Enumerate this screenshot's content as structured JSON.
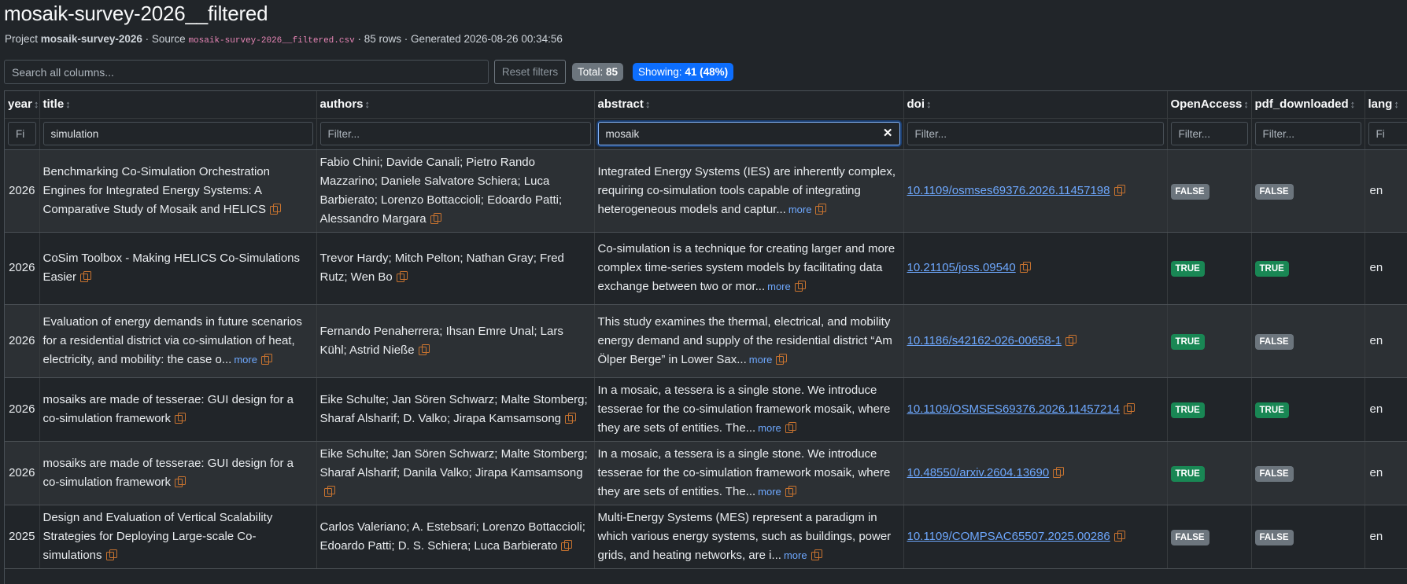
{
  "header": {
    "title": "mosaik-survey-2026__filtered",
    "project_prefix": "Project",
    "project_name": "mosaik-survey-2026",
    "source_prefix": "· Source",
    "source_file": "mosaik-survey-2026__filtered.csv",
    "rows_text": "· 85 rows · Generated 2026-08-26 00:34:56"
  },
  "toolbar": {
    "search_placeholder": "Search all columns...",
    "reset_label": "Reset filters",
    "total_label": "Total:",
    "total_value": "85",
    "showing_label": "Showing:",
    "showing_value": "41 (48%)"
  },
  "columns": [
    {
      "label": "year",
      "filter_value": "",
      "filter_placeholder": "Fi"
    },
    {
      "label": "title",
      "filter_value": "simulation",
      "filter_placeholder": "Filter..."
    },
    {
      "label": "authors",
      "filter_value": "",
      "filter_placeholder": "Filter..."
    },
    {
      "label": "abstract",
      "filter_value": "mosaik",
      "filter_placeholder": "Filter..."
    },
    {
      "label": "doi",
      "filter_value": "",
      "filter_placeholder": "Filter..."
    },
    {
      "label": "OpenAccess",
      "filter_value": "",
      "filter_placeholder": "Filter..."
    },
    {
      "label": "pdf_downloaded",
      "filter_value": "",
      "filter_placeholder": "Filter..."
    },
    {
      "label": "lang",
      "filter_value": "",
      "filter_placeholder": "Fi"
    }
  ],
  "sort_icon": "↕",
  "clear_icon": "✕",
  "more_label": "more",
  "colors": {
    "bg": "#212529",
    "accent": "#0d6efd",
    "link": "#6ea8fe",
    "true_badge": "#198754",
    "false_badge": "#6c757d",
    "copy_icon": "#c8732f"
  },
  "rows": [
    {
      "year": "2026",
      "title": "Benchmarking Co-Simulation Orchestration Engines for Integrated Energy Systems: A Comparative Study of Mosaik and HELICS",
      "authors": "Fabio Chini; Davide Canali; Pietro Rando Mazzarino; Daniele Salvatore Schiera; Luca Barbierato; Lorenzo Bottaccioli; Edoardo Patti; Alessandro Margara",
      "abstract": "Integrated Energy Systems (IES) are inherently complex, requiring co-simulation tools capable of integrating heterogeneous models and captur...",
      "doi": "10.1109/osmses69376.2026.11457198",
      "open_access": "FALSE",
      "pdf_downloaded": "FALSE",
      "lang": "en"
    },
    {
      "year": "2026",
      "title": "CoSim Toolbox - Making HELICS Co-Simulations Easier",
      "authors": "Trevor Hardy; Mitch Pelton; Nathan Gray; Fred Rutz; Wen Bo",
      "abstract": "Co-simulation is a technique for creating larger and more complex time-series system models by facilitating data exchange between two or mor...",
      "doi": "10.21105/joss.09540",
      "open_access": "TRUE",
      "pdf_downloaded": "TRUE",
      "lang": "en"
    },
    {
      "year": "2026",
      "title": "Evaluation of energy demands in future scenarios for a residential district via co-simulation of heat, electricity, and mobility: the case o...",
      "authors": "Fernando Penaherrera; Ihsan Emre Unal; Lars Kühl; Astrid Nieße",
      "abstract": "This study examines the thermal, electrical, and mobility energy demand and supply of the residential district “Am Ölper Berge” in Lower Sax...",
      "doi": "10.1186/s42162-026-00658-1",
      "open_access": "TRUE",
      "pdf_downloaded": "FALSE",
      "lang": "en"
    },
    {
      "year": "2026",
      "title": "mosaiks are made of tesserae: GUI design for a co-simulation framework",
      "authors": "Eike Schulte; Jan Sören Schwarz; Malte Stomberg; Sharaf Alsharif; D. Valko; Jirapa Kamsamsong",
      "abstract": "In a mosaic, a tessera is a single stone. We introduce tesserae for the co-simulation framework mosaik, where they are sets of entities. The...",
      "doi": "10.1109/OSMSES69376.2026.11457214",
      "open_access": "TRUE",
      "pdf_downloaded": "TRUE",
      "lang": "en"
    },
    {
      "year": "2026",
      "title": "mosaiks are made of tesserae: GUI design for a co-simulation framework",
      "authors": "Eike Schulte; Jan Sören Schwarz; Malte Stomberg; Sharaf Alsharif; Danila Valko; Jirapa Kamsamsong",
      "abstract": "In a mosaic, a tessera is a single stone. We introduce tesserae for the co-simulation framework mosaik, where they are sets of entities. The...",
      "doi": "10.48550/arxiv.2604.13690",
      "open_access": "TRUE",
      "pdf_downloaded": "FALSE",
      "lang": "en"
    },
    {
      "year": "2025",
      "title": "Design and Evaluation of Vertical Scalability Strategies for Deploying Large-scale Co-simulations",
      "authors": "Carlos Valeriano; A. Estebsari; Lorenzo Bottaccioli; Edoardo Patti; D. S. Schiera; Luca Barbierato",
      "abstract": "Multi-Energy Systems (MES) represent a paradigm in which various energy systems, such as buildings, power grids, and heating networks, are i...",
      "doi": "10.1109/COMPSAC65507.2025.00286",
      "open_access": "FALSE",
      "pdf_downloaded": "FALSE",
      "lang": "en"
    }
  ]
}
